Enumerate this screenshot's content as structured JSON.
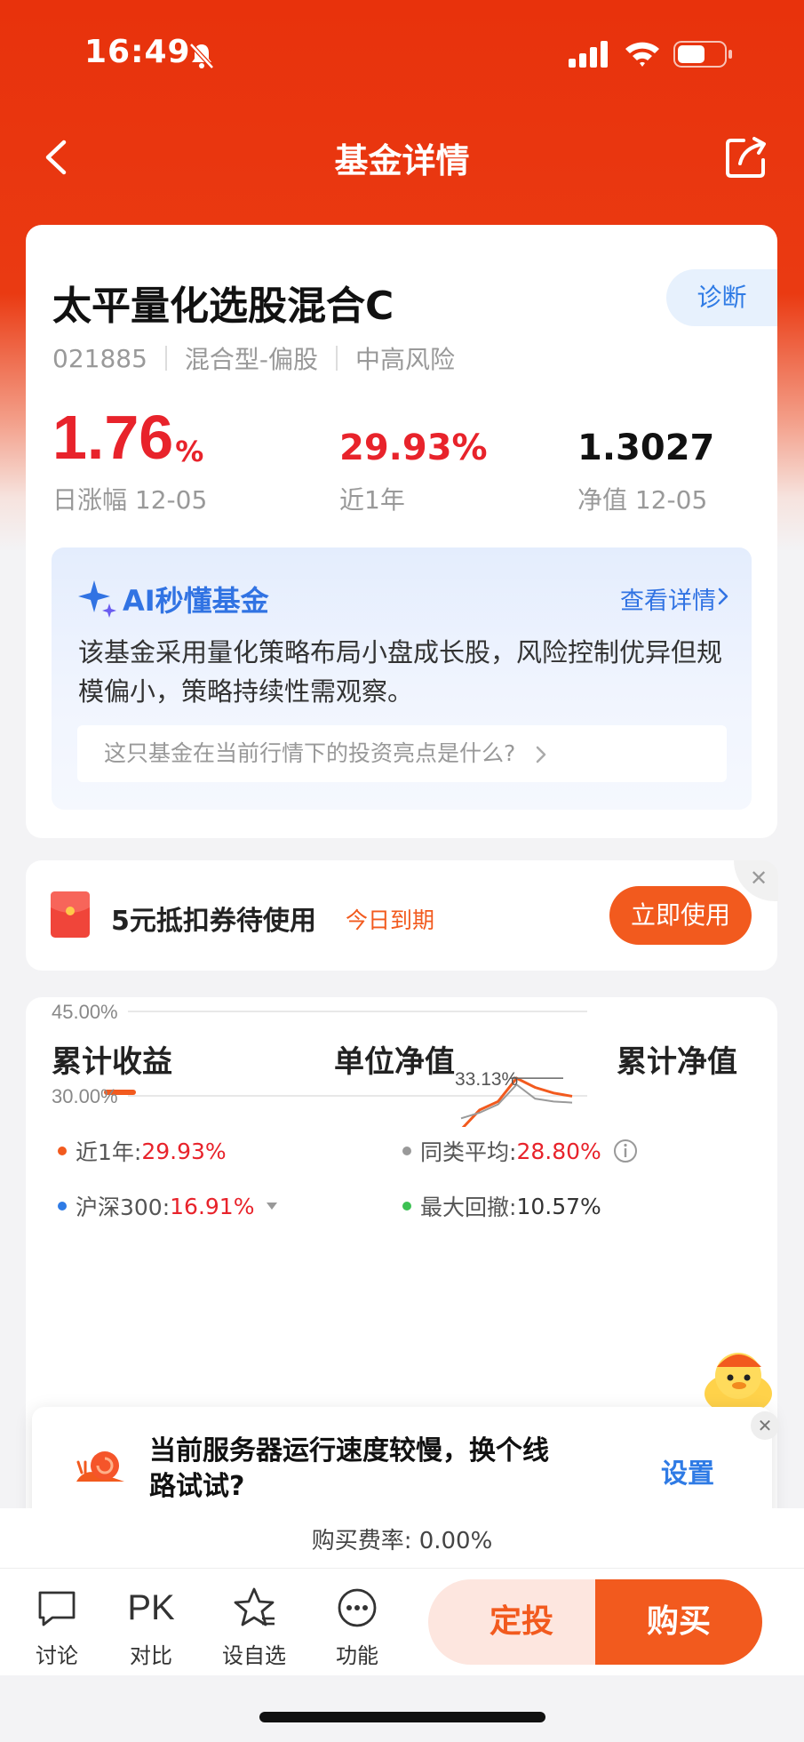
{
  "status_bar": {
    "time": "16:49"
  },
  "nav": {
    "title": "基金详情"
  },
  "fund": {
    "name": "太平量化选股混合C",
    "diagnose_label": "诊断",
    "code": "021885",
    "type": "混合型-偏股",
    "risk": "中高风险",
    "daily_change_value": "1.76",
    "daily_change_unit": "%",
    "daily_change_label": "日涨幅 12-05",
    "year_return": "29.93%",
    "year_return_label": "近1年",
    "nav_value": "1.3027",
    "nav_label": "净值 12-05"
  },
  "ai": {
    "title": "AI秒懂基金",
    "detail_link": "查看详情",
    "summary": "该基金采用量化策略布局小盘成长股，风险控制优异但规模偏小，策略持续性需观察。",
    "question": "这只基金在当前行情下的投资亮点是什么?"
  },
  "coupon": {
    "text": "5元抵扣券待使用",
    "expire": "今日到期",
    "button": "立即使用"
  },
  "chart_tabs": [
    "累计收益",
    "单位净值",
    "累计净值"
  ],
  "legend": {
    "l1_label": "近1年:",
    "l1_value": "29.93%",
    "l2_label": "同类平均:",
    "l2_value": "28.80%",
    "l3_label": "沪深300:",
    "l3_value": "16.91%",
    "l4_label": "最大回撤:",
    "l4_value": "10.57%"
  },
  "colors": {
    "accent": "#f25a1e",
    "up_red": "#e8232b",
    "link_blue": "#2f7be5",
    "legend_gray": "#999999",
    "legend_blue": "#2f7be5",
    "legend_green": "#3cc153"
  },
  "chart_data": {
    "type": "line",
    "y_tick_labels": [
      "45.00%",
      "30.00%"
    ],
    "y_ticks": [
      45,
      30
    ],
    "annotations": [
      "33.13%"
    ],
    "series": [
      {
        "name": "近1年",
        "values": [
          24.0,
          27.5,
          29.0,
          33.13,
          31.5,
          30.5,
          29.93
        ]
      },
      {
        "name": "同类平均",
        "values": [
          26.0,
          27.0,
          28.5,
          32.0,
          29.5,
          29.0,
          28.8
        ]
      }
    ]
  },
  "toast": {
    "text": "当前服务器运行速度较慢，换个线路试试?",
    "action": "设置"
  },
  "fee": {
    "text": "购买费率: 0.00%"
  },
  "bottom_bar": {
    "discuss": "讨论",
    "compare_icon_text": "PK",
    "compare": "对比",
    "watchlist": "设自选",
    "functions": "功能",
    "sip": "定投",
    "buy": "购买"
  }
}
